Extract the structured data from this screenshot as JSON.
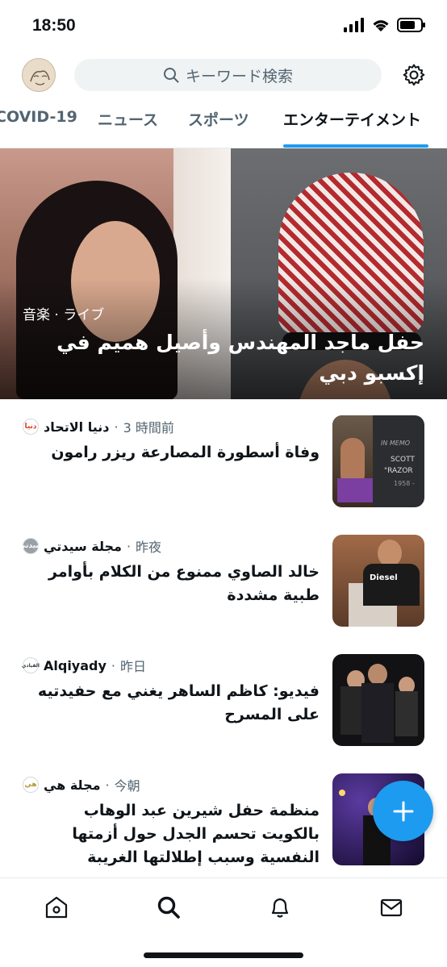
{
  "status_bar": {
    "time": "18:50"
  },
  "search": {
    "placeholder": "キーワード検索"
  },
  "tabs": [
    {
      "label": "COVID-19"
    },
    {
      "label": "ニュース"
    },
    {
      "label": "スポーツ"
    },
    {
      "label": "エンターテイメント",
      "active": true
    }
  ],
  "hero": {
    "category": "音楽 · ライブ",
    "title": "حفل ماجد المهندس وأصيل هميم في إكسبو دبي"
  },
  "feed": [
    {
      "source": "دنيا الاتحاد",
      "time": "3 時間前",
      "headline": "وفاة أسطورة المصارعة ريزر رامون",
      "logo": "دنيا",
      "logo_color": "#d4432a"
    },
    {
      "source": "مجلة سيدتي",
      "time": "昨夜",
      "headline": "خالد الصاوي ممنوع من الكلام بأوامر طبية مشددة",
      "logo": "سيدتي",
      "logo_color": "#9aa0a6"
    },
    {
      "source": "Alqiyady",
      "time": "昨日",
      "headline": "فيديو: كاظم الساهر يغني مع حفيدتيه على المسرح",
      "logo": "القيادي",
      "logo_color": "#333333"
    },
    {
      "source": "مجلة هي",
      "time": "今朝",
      "headline": "منظمة حفل شيرين عبد الوهاب بالكويت تحسم الجدل حول أزمتها النفسية وسبب إطلالتها الغريبة",
      "logo": "هي",
      "logo_color": "#b8962e"
    }
  ],
  "thumbs": {
    "t1_text": "IN MEMO",
    "t1_name": "SCOTT",
    "t1_nick": "\"RAZOR",
    "t1_year": "1958 -",
    "t2_shirt": "Diesel"
  },
  "colors": {
    "accent": "#1d9bf0",
    "text": "#0f1419",
    "muted": "#536471"
  },
  "bottom_nav": [
    "home-icon",
    "search-icon",
    "bell-icon",
    "mail-icon"
  ]
}
